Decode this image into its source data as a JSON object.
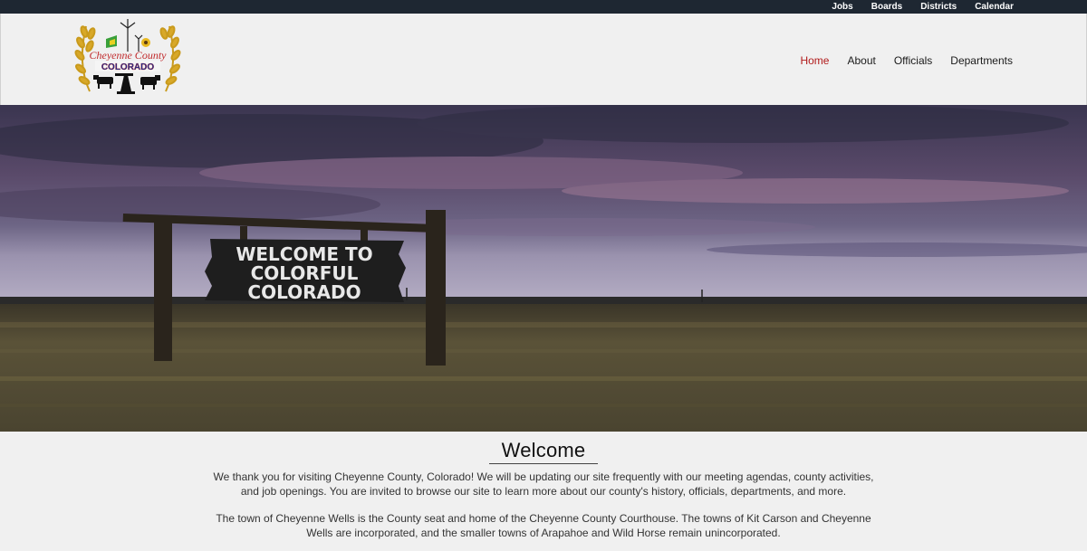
{
  "topbar": {
    "links": [
      "Jobs",
      "Boards",
      "Districts",
      "Calendar"
    ]
  },
  "logo": {
    "line1": "Cheyenne County",
    "line2": "COLORADO"
  },
  "nav": {
    "items": [
      "Home",
      "About",
      "Officials",
      "Departments"
    ],
    "active": "Home"
  },
  "hero": {
    "sign_line1": "WELCOME TO",
    "sign_line2": "COLORFUL",
    "sign_line3": "COLORADO"
  },
  "welcome": {
    "title": "Welcome",
    "para1": "We thank you for visiting Cheyenne County, Colorado! We will be updating our site frequently with our meeting agendas, county activities, and job openings. You are invited to browse our site to learn more about our county's history, officials, departments, and more.",
    "para2": "The town of Cheyenne Wells is the County seat and home of the Cheyenne County Courthouse. The towns of Kit Carson and Cheyenne Wells are incorporated, and the smaller towns of Arapahoe and Wild Horse remain unincorporated."
  },
  "colors": {
    "topbar": "#1e2732",
    "nav_active": "#b11a1a",
    "background": "#f0f0f0"
  }
}
